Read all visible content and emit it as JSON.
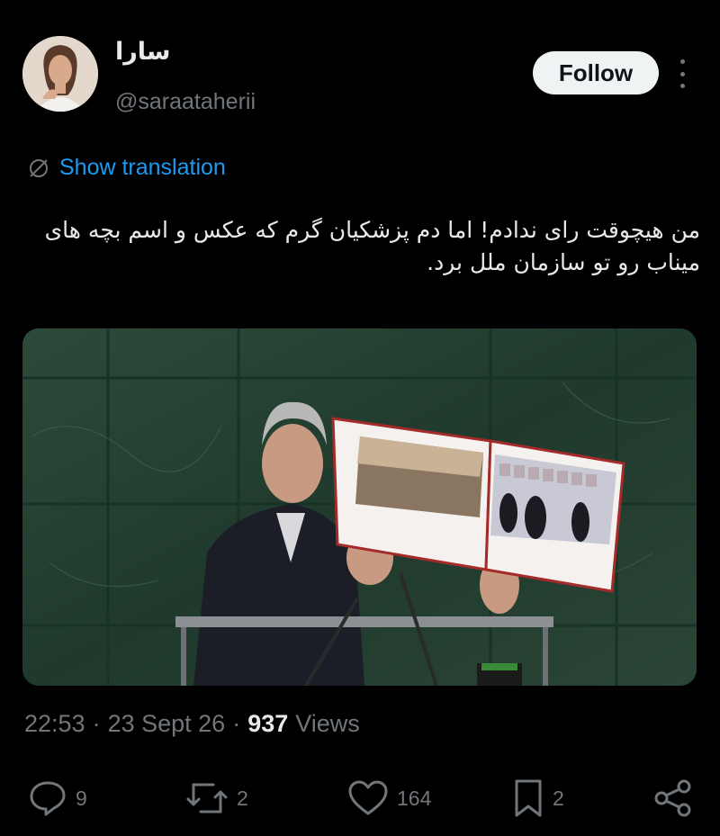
{
  "author": {
    "display_name": "سارا",
    "handle": "@saraataherii",
    "follow_label": "Follow"
  },
  "translation": {
    "label": "Show translation",
    "icon": "globe-slash-icon"
  },
  "tweet": {
    "text": "من هیچوقت رای ندادم! اما دم پزشکیان گرم که عکس و اسم بچه های میناب رو تو سازمان ملل برد."
  },
  "meta": {
    "time": "22:53",
    "date": "23 Sept 26",
    "separator": "·",
    "views_count": "937",
    "views_label": "Views"
  },
  "actions": {
    "replies": "9",
    "reposts": "2",
    "likes": "164",
    "bookmarks": "2"
  },
  "colors": {
    "background": "#000000",
    "text": "#e7e9ea",
    "secondary": "#71767b",
    "link": "#1d9bf0",
    "follow_bg": "#eff3f4"
  }
}
